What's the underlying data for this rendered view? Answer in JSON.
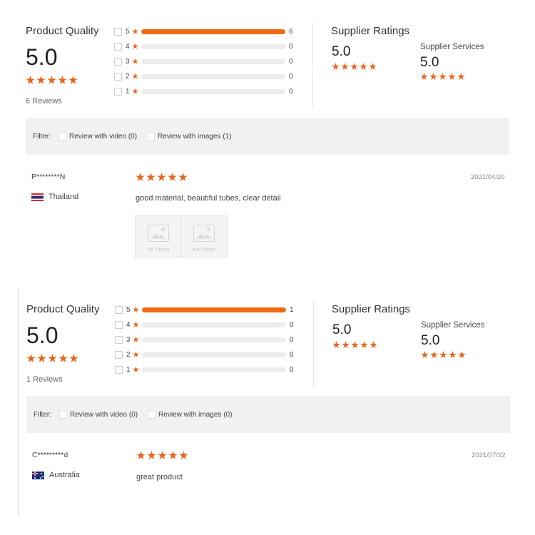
{
  "colors": {
    "accent": "#e8641b",
    "bar_fill": "#ee6a12",
    "bar_track": "#ececec",
    "filter_bg": "#f1f1f1"
  },
  "reviews": [
    {
      "product_quality": {
        "title": "Product Quality",
        "score": "5.0",
        "stars": 5,
        "count_label": "6 Reviews"
      },
      "breakdown": [
        {
          "stars": "5",
          "count": "6",
          "fraction": 1.0
        },
        {
          "stars": "4",
          "count": "0",
          "fraction": 0
        },
        {
          "stars": "3",
          "count": "0",
          "fraction": 0
        },
        {
          "stars": "2",
          "count": "0",
          "fraction": 0
        },
        {
          "stars": "1",
          "count": "0",
          "fraction": 0
        }
      ],
      "supplier_ratings": {
        "title": "Supplier Ratings",
        "score": "5.0",
        "stars": 5
      },
      "supplier_services": {
        "title": "Supplier Services",
        "score": "5.0",
        "stars": 5
      },
      "filter": {
        "label": "Filter:",
        "video_option": "Review with video (0)",
        "images_option": "Review with images (1)"
      },
      "review": {
        "reviewer": "P********N",
        "country": "Thailand",
        "flag_icon": "thailand-flag-icon",
        "stars": 5,
        "date": "2021/04/20",
        "comment": "good material, beautiful tubes, clear detail",
        "photos": [
          {
            "label": "No Photo"
          },
          {
            "label": "No Photo"
          }
        ]
      }
    },
    {
      "product_quality": {
        "title": "Product Quality",
        "score": "5.0",
        "stars": 5,
        "count_label": "1 Reviews"
      },
      "breakdown": [
        {
          "stars": "5",
          "count": "1",
          "fraction": 1.0
        },
        {
          "stars": "4",
          "count": "0",
          "fraction": 0
        },
        {
          "stars": "3",
          "count": "0",
          "fraction": 0
        },
        {
          "stars": "2",
          "count": "0",
          "fraction": 0
        },
        {
          "stars": "1",
          "count": "0",
          "fraction": 0
        }
      ],
      "supplier_ratings": {
        "title": "Supplier Ratings",
        "score": "5.0",
        "stars": 5
      },
      "supplier_services": {
        "title": "Supplier Services",
        "score": "5.0",
        "stars": 5
      },
      "filter": {
        "label": "Filter:",
        "video_option": "Review with video (0)",
        "images_option": "Review with images (0)"
      },
      "review": {
        "reviewer": "C*********d",
        "country": "Australia",
        "flag_icon": "australia-flag-icon",
        "stars": 5,
        "date": "2021/07/22",
        "comment": "great product"
      }
    }
  ]
}
